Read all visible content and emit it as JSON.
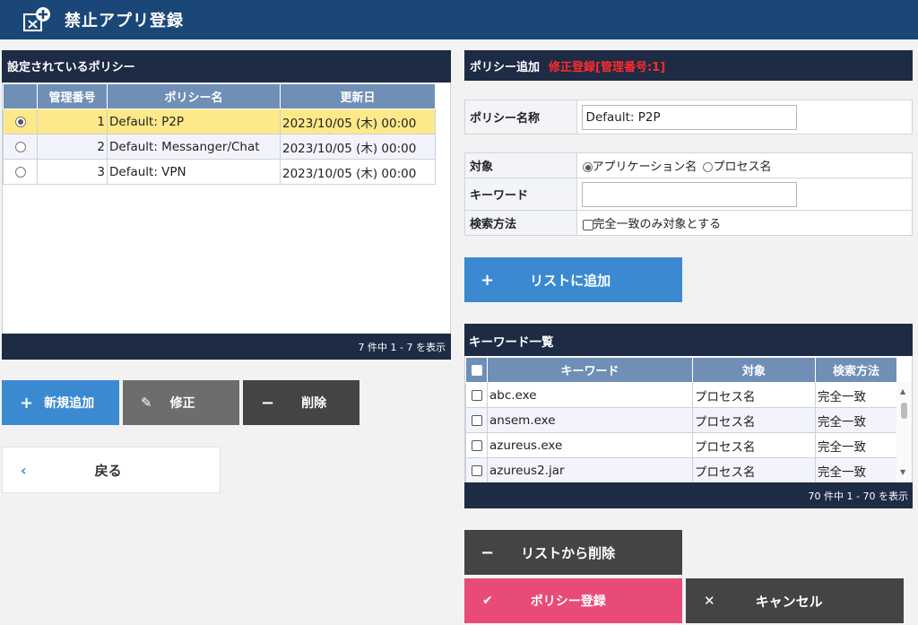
{
  "header": {
    "title": "禁止アプリ登録",
    "icon": "app-block-add-icon"
  },
  "policy_list": {
    "title": "設定されているポリシー",
    "columns": [
      "管理番号",
      "ポリシー名",
      "更新日"
    ],
    "rows": [
      {
        "num": "1",
        "name": "Default: P2P",
        "date": "2023/10/05 (木) 00:00",
        "selected": true
      },
      {
        "num": "2",
        "name": "Default: Messanger/Chat",
        "date": "2023/10/05 (木) 00:00",
        "selected": false
      },
      {
        "num": "3",
        "name": "Default: VPN",
        "date": "2023/10/05 (木) 00:00",
        "selected": false
      }
    ],
    "footer": "7 件中 1 - 7 を表示"
  },
  "left_buttons": {
    "new": "新規追加",
    "edit": "修正",
    "delete": "削除",
    "back": "戻る"
  },
  "policy_form": {
    "title": "ポリシー追加",
    "mode": "修正登録[管理番号:1]",
    "name_label": "ポリシー名称",
    "name_value": "Default: P2P",
    "target_label": "対象",
    "target_opt1": "アプリケーション名",
    "target_opt2": "プロセス名",
    "keyword_label": "キーワード",
    "keyword_value": "",
    "method_label": "検索方法",
    "method_option": "完全一致のみ対象とする",
    "add_button": "リストに追加"
  },
  "keyword_list": {
    "title": "キーワード一覧",
    "columns": [
      "キーワード",
      "対象",
      "検索方法"
    ],
    "rows": [
      {
        "keyword": "abc.exe",
        "target": "プロセス名",
        "method": "完全一致"
      },
      {
        "keyword": "ansem.exe",
        "target": "プロセス名",
        "method": "完全一致"
      },
      {
        "keyword": "azureus.exe",
        "target": "プロセス名",
        "method": "完全一致"
      },
      {
        "keyword": "azureus2.jar",
        "target": "プロセス名",
        "method": "完全一致"
      }
    ],
    "footer": "70 件中 1 - 70 を表示"
  },
  "right_buttons": {
    "remove": "リストから削除",
    "register": "ポリシー登録",
    "cancel": "キャンセル"
  },
  "colors": {
    "header": "#1b4778",
    "panel": "#1d2b45",
    "blue_button": "#3b8ad1",
    "gray_button": "#6d6d6d",
    "dark_button": "#444444",
    "pink_button": "#e94b78",
    "selected_row": "#fde98a",
    "mode_text": "#ff2a2a"
  }
}
